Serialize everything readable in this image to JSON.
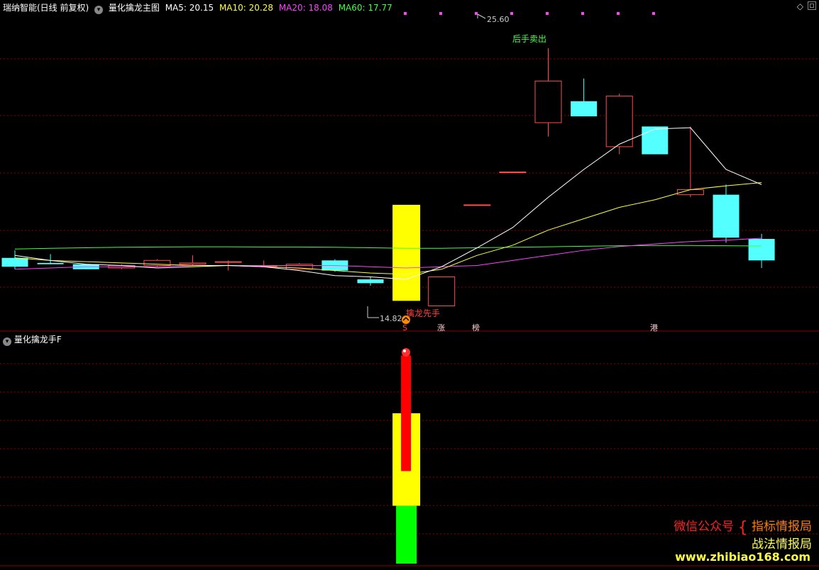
{
  "header": {
    "stock": "瑞纳智能(日线 前复权)",
    "indicator": "量化擒龙主图",
    "ma5": "MA5: 20.15",
    "ma10": "MA10: 20.28",
    "ma20": "MA20: 18.08",
    "ma60": "MA60: 17.77",
    "menu_icon": "chevron-down-icon"
  },
  "sub_header": {
    "indicator": "量化擒龙手F"
  },
  "annotations": {
    "high": "25.60",
    "low": "14.82",
    "sell": "后手卖出",
    "buy": "擒龙先手",
    "s": "S",
    "zhang": "涨",
    "bang": "榜",
    "gang": "港"
  },
  "watermark": {
    "wechat": "微信公众号",
    "brand1": "指标情报局",
    "brand2": "战法情报局",
    "site": "www.zhibiao168.com"
  },
  "colors": {
    "up": "#ff4d4d",
    "down": "#54ffff",
    "ma5": "#ffffff",
    "ma10": "#ffff40",
    "ma20": "#ff40ff",
    "ma60": "#40ff40",
    "grid": "#8b0000",
    "signal_yellow": "#ffff00",
    "signal_red": "#ff0000",
    "signal_green": "#00ff00"
  },
  "chart_data": {
    "type": "candlestick",
    "ohlc": [
      [
        17.3,
        17.6,
        16.85,
        16.95
      ],
      [
        17.1,
        17.45,
        17.05,
        17.05
      ],
      [
        17.05,
        17.05,
        16.85,
        16.85
      ],
      [
        16.9,
        17.05,
        16.85,
        17.0
      ],
      [
        17.0,
        17.25,
        16.95,
        17.2
      ],
      [
        17.05,
        17.4,
        17.0,
        17.1
      ],
      [
        17.15,
        17.2,
        16.8,
        17.15
      ],
      [
        17.0,
        17.2,
        16.95,
        17.0
      ],
      [
        16.85,
        17.1,
        16.85,
        17.05
      ],
      [
        17.2,
        17.25,
        16.75,
        16.8
      ],
      [
        16.45,
        16.55,
        16.2,
        16.3
      ],
      [
        15.9,
        15.9,
        15.9,
        15.9
      ],
      [
        15.4,
        16.55,
        15.4,
        16.55
      ],
      [
        19.4,
        19.4,
        19.4,
        19.4
      ],
      [
        20.7,
        20.7,
        20.7,
        20.7
      ],
      [
        22.65,
        25.6,
        22.1,
        24.3
      ],
      [
        23.5,
        24.4,
        22.9,
        22.9
      ],
      [
        21.7,
        23.8,
        21.4,
        23.7
      ],
      [
        22.5,
        22.5,
        21.4,
        21.4
      ],
      [
        19.8,
        22.5,
        19.7,
        20.0
      ],
      [
        19.8,
        20.2,
        17.9,
        18.1
      ],
      [
        18.05,
        18.25,
        16.9,
        17.2
      ]
    ],
    "ma5": [
      17.4,
      17.2,
      17.05,
      17.0,
      16.9,
      16.95,
      17.0,
      16.95,
      16.8,
      16.6,
      16.55,
      16.45,
      16.95,
      17.7,
      18.5,
      19.7,
      20.8,
      21.8,
      22.4,
      22.45,
      20.8,
      20.2
    ],
    "ma10": [
      17.3,
      17.2,
      17.15,
      17.1,
      17.05,
      17.0,
      17.0,
      16.95,
      16.9,
      16.8,
      16.7,
      16.65,
      16.85,
      17.4,
      17.8,
      18.4,
      18.85,
      19.3,
      19.6,
      20.0,
      20.15,
      20.28
    ],
    "ma20": [
      16.85,
      16.9,
      16.95,
      16.95,
      16.95,
      17.0,
      17.0,
      17.0,
      17.0,
      17.0,
      16.95,
      16.9,
      16.95,
      17.0,
      17.2,
      17.4,
      17.6,
      17.75,
      17.85,
      17.95,
      18.0,
      18.08
    ],
    "ma60": [
      17.65,
      17.68,
      17.7,
      17.72,
      17.73,
      17.74,
      17.74,
      17.73,
      17.73,
      17.72,
      17.7,
      17.68,
      17.68,
      17.7,
      17.72,
      17.74,
      17.76,
      17.78,
      17.79,
      17.79,
      17.78,
      17.77
    ],
    "ylim": [
      14.6,
      27.0
    ],
    "signal_index": 11,
    "signal_bars": {
      "yellow_range": [
        0,
        1.6
      ],
      "red_range": [
        0.6,
        2.6
      ],
      "green_range": [
        -1,
        0
      ],
      "ylim": [
        -1,
        2.8
      ]
    }
  }
}
